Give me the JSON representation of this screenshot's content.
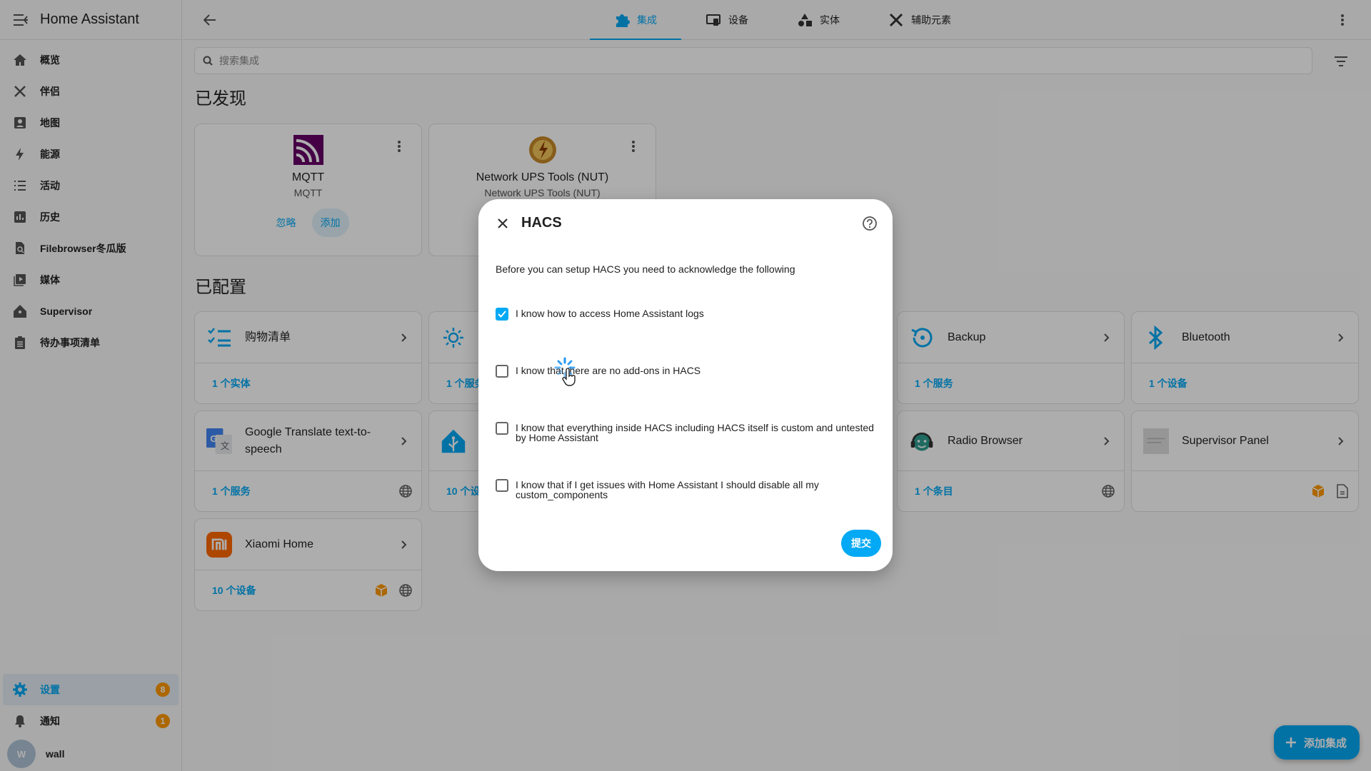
{
  "app": {
    "title": "Home Assistant"
  },
  "sidebar": {
    "items": [
      {
        "label": "概览",
        "icon": "home-icon"
      },
      {
        "label": "伴侣",
        "icon": "wrench-icon"
      },
      {
        "label": "地图",
        "icon": "map-icon"
      },
      {
        "label": "能源",
        "icon": "lightning-icon"
      },
      {
        "label": "活动",
        "icon": "list-icon"
      },
      {
        "label": "历史",
        "icon": "chart-icon"
      },
      {
        "label": "Filebrowser冬瓜版",
        "icon": "file-search-icon"
      },
      {
        "label": "媒体",
        "icon": "media-icon"
      },
      {
        "label": "Supervisor",
        "icon": "home-assistant-icon"
      },
      {
        "label": "待办事项清单",
        "icon": "clipboard-list-icon"
      }
    ],
    "settings": {
      "label": "设置",
      "badge": "8"
    },
    "notifications": {
      "label": "通知",
      "badge": "1"
    },
    "user": {
      "label": "wall",
      "initial": "W"
    }
  },
  "topbar": {
    "tabs": [
      {
        "label": "集成",
        "icon": "puzzle-icon"
      },
      {
        "label": "设备",
        "icon": "devices-icon"
      },
      {
        "label": "实体",
        "icon": "shapes-icon"
      },
      {
        "label": "辅助元素",
        "icon": "tools-icon"
      }
    ]
  },
  "search": {
    "placeholder": "搜索集成"
  },
  "discovered": {
    "title": "已发现",
    "cards": [
      {
        "name": "MQTT",
        "sub": "MQTT",
        "ignore": "忽略",
        "add": "添加"
      },
      {
        "name": "Network UPS Tools (NUT)",
        "sub": "Network UPS Tools (NUT)"
      }
    ]
  },
  "configured": {
    "title": "已配置",
    "cards": [
      {
        "name": "购物清单",
        "footer": "1 个实体"
      },
      {
        "name": "",
        "footer": "1 个服务"
      },
      {
        "name": "Backup",
        "footer": "1 个服务"
      },
      {
        "name": "Bluetooth",
        "footer": "1 个设备"
      },
      {
        "name": "Google Translate text-to-speech",
        "footer": "1 个服务"
      },
      {
        "name": "",
        "footer": "10 个设备"
      },
      {
        "name": "Radio Browser",
        "footer": "1 个条目"
      },
      {
        "name": "Supervisor Panel",
        "footer": ""
      },
      {
        "name": "Xiaomi Home",
        "footer": "10 个设备"
      }
    ]
  },
  "dialog": {
    "title": "HACS",
    "intro": "Before you can setup HACS you need to acknowledge the following",
    "acks": [
      {
        "text": "I know how to access Home Assistant logs",
        "checked": true
      },
      {
        "text": "I know that there are no add-ons in HACS",
        "checked": false
      },
      {
        "text": "I know that everything inside HACS including HACS itself is custom and untested by Home Assistant",
        "checked": false
      },
      {
        "text": "I know that if I get issues with Home Assistant I should disable all my custom_components",
        "checked": false
      }
    ],
    "submit": "提交"
  },
  "fab": {
    "label": "添加集成"
  },
  "colors": {
    "accent": "#03a9f4",
    "badge": "#ff9800"
  }
}
